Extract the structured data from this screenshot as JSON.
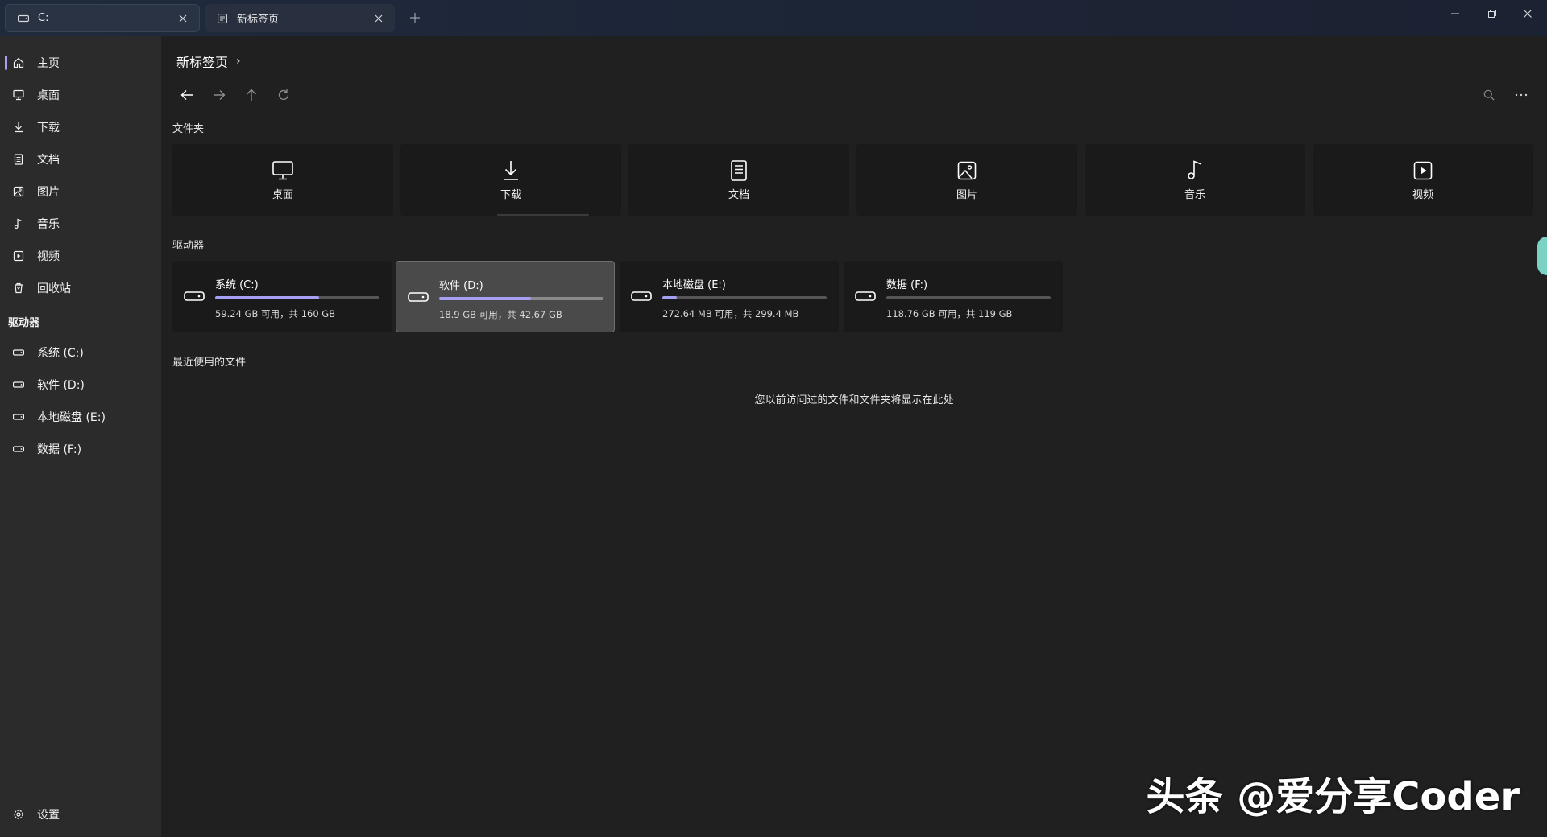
{
  "tabs": [
    {
      "label": "C:",
      "icon": "drive-icon",
      "active": true
    },
    {
      "label": "新标签页",
      "icon": "page-icon",
      "active": false
    }
  ],
  "window_controls": [
    "minimize",
    "restore",
    "close"
  ],
  "sidebar": {
    "items": [
      {
        "label": "主页",
        "icon": "home-icon",
        "active": true
      },
      {
        "label": "桌面",
        "icon": "desktop-icon"
      },
      {
        "label": "下载",
        "icon": "download-icon"
      },
      {
        "label": "文档",
        "icon": "document-icon"
      },
      {
        "label": "图片",
        "icon": "picture-icon"
      },
      {
        "label": "音乐",
        "icon": "music-icon"
      },
      {
        "label": "视频",
        "icon": "video-icon"
      },
      {
        "label": "回收站",
        "icon": "recycle-bin-icon"
      }
    ],
    "drives_heading": "驱动器",
    "drives": [
      {
        "label": "系统 (C:)"
      },
      {
        "label": "软件 (D:)"
      },
      {
        "label": "本地磁盘 (E:)"
      },
      {
        "label": "数据 (F:)"
      }
    ],
    "settings_label": "设置"
  },
  "breadcrumb": {
    "current": "新标签页",
    "separator": "›"
  },
  "sections": {
    "folders_title": "文件夹",
    "drives_title": "驱动器",
    "recent_title": "最近使用的文件"
  },
  "folders": [
    {
      "label": "桌面",
      "icon": "desktop-icon"
    },
    {
      "label": "下载",
      "icon": "download-icon"
    },
    {
      "label": "文档",
      "icon": "document-icon"
    },
    {
      "label": "图片",
      "icon": "picture-icon"
    },
    {
      "label": "音乐",
      "icon": "music-icon"
    },
    {
      "label": "视频",
      "icon": "video-icon"
    }
  ],
  "drives": [
    {
      "name": "系统 (C:)",
      "info": "59.24 GB 可用，共 160 GB",
      "used_fraction": 0.63
    },
    {
      "name": "软件 (D:)",
      "info": "18.9 GB 可用，共 42.67 GB",
      "used_fraction": 0.56
    },
    {
      "name": "本地磁盘 (E:)",
      "info": "272.64 MB 可用，共 299.4 MB",
      "used_fraction": 0.09
    },
    {
      "name": "数据 (F:)",
      "info": "118.76 GB 可用，共 119 GB",
      "used_fraction": 0.0
    }
  ],
  "recent": {
    "empty_message": "您以前访问过的文件和文件夹将显示在此处"
  },
  "watermark": "头条 @爱分享Coder",
  "colors": {
    "accent": "#a6a0f4",
    "background": "#202020",
    "sidebar": "#2b2b2b",
    "card": "#1a1a1a"
  }
}
